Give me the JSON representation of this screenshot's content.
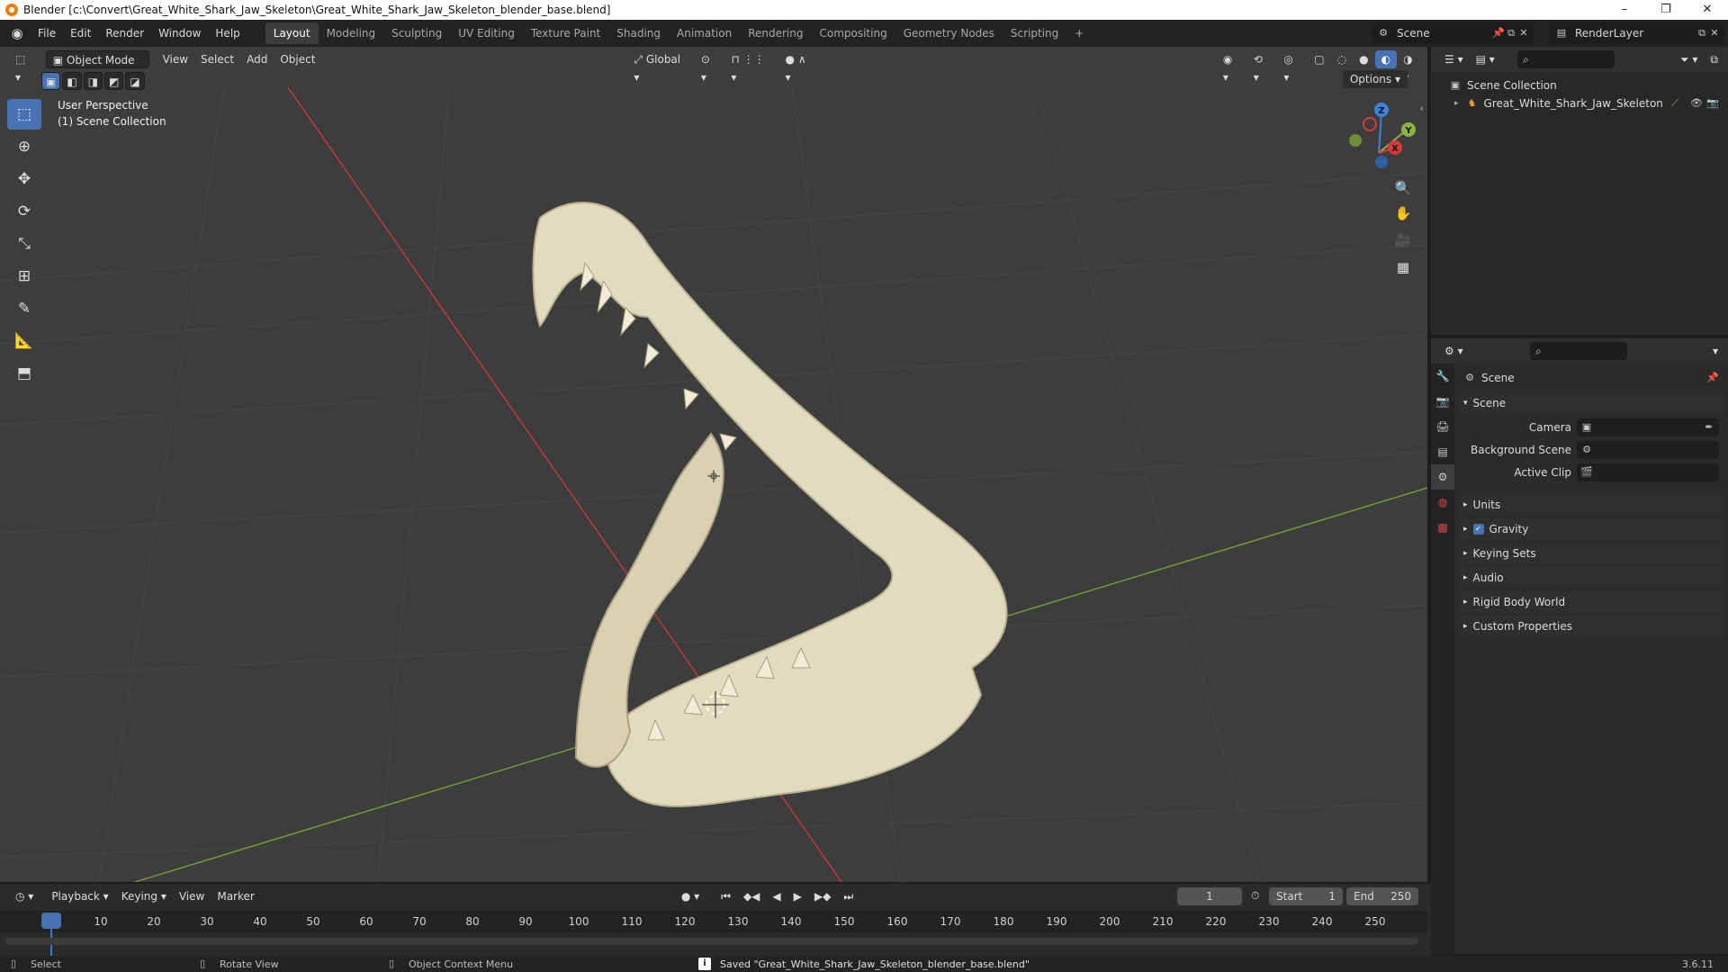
{
  "window": {
    "title": "Blender [c:\\Convert\\Great_White_Shark_Jaw_Skeleton\\Great_White_Shark_Jaw_Skeleton_blender_base.blend]",
    "minimize": "–",
    "maximize": "❐",
    "close": "✕"
  },
  "menu": {
    "items": [
      "File",
      "Edit",
      "Render",
      "Window",
      "Help"
    ]
  },
  "workspaces": {
    "tabs": [
      "Layout",
      "Modeling",
      "Sculpting",
      "UV Editing",
      "Texture Paint",
      "Shading",
      "Animation",
      "Rendering",
      "Compositing",
      "Geometry Nodes",
      "Scripting"
    ],
    "active": "Layout",
    "add": "+"
  },
  "scene_selector": {
    "value": "Scene"
  },
  "layer_selector": {
    "value": "RenderLayer"
  },
  "viewport": {
    "mode": "Object Mode",
    "menus": [
      "View",
      "Select",
      "Add",
      "Object"
    ],
    "orientation": "Global",
    "options": "Options",
    "overlay_line1": "User Perspective",
    "overlay_line2": "(1) Scene Collection",
    "gizmo": {
      "x": "X",
      "y": "Y",
      "z": "Z"
    },
    "colors": {
      "x_axis": "#d43c3c",
      "y_axis": "#8ab33f",
      "z_axis": "#3d82e0",
      "bone": "#e3dbbd"
    }
  },
  "outliner": {
    "root": "Scene Collection",
    "object": "Great_White_Shark_Jaw_Skeleton"
  },
  "properties": {
    "context": "Scene",
    "panel_scene": "Scene",
    "camera_label": "Camera",
    "background_label": "Background Scene",
    "clip_label": "Active Clip",
    "panels": [
      "Units",
      "Gravity",
      "Keying Sets",
      "Audio",
      "Rigid Body World",
      "Custom Properties"
    ],
    "gravity_checked": true
  },
  "timeline": {
    "menus": [
      "Playback",
      "Keying",
      "View",
      "Marker"
    ],
    "current_frame": "1",
    "start_label": "Start",
    "start_value": "1",
    "end_label": "End",
    "end_value": "250",
    "ticks": [
      "1",
      "10",
      "20",
      "30",
      "40",
      "50",
      "60",
      "70",
      "80",
      "90",
      "100",
      "110",
      "120",
      "130",
      "140",
      "150",
      "160",
      "170",
      "180",
      "190",
      "200",
      "210",
      "220",
      "230",
      "240",
      "250"
    ]
  },
  "status": {
    "select": "Select",
    "rotate": "Rotate View",
    "context_menu": "Object Context Menu",
    "message": "Saved \"Great_White_Shark_Jaw_Skeleton_blender_base.blend\"",
    "version": "3.6.11"
  }
}
